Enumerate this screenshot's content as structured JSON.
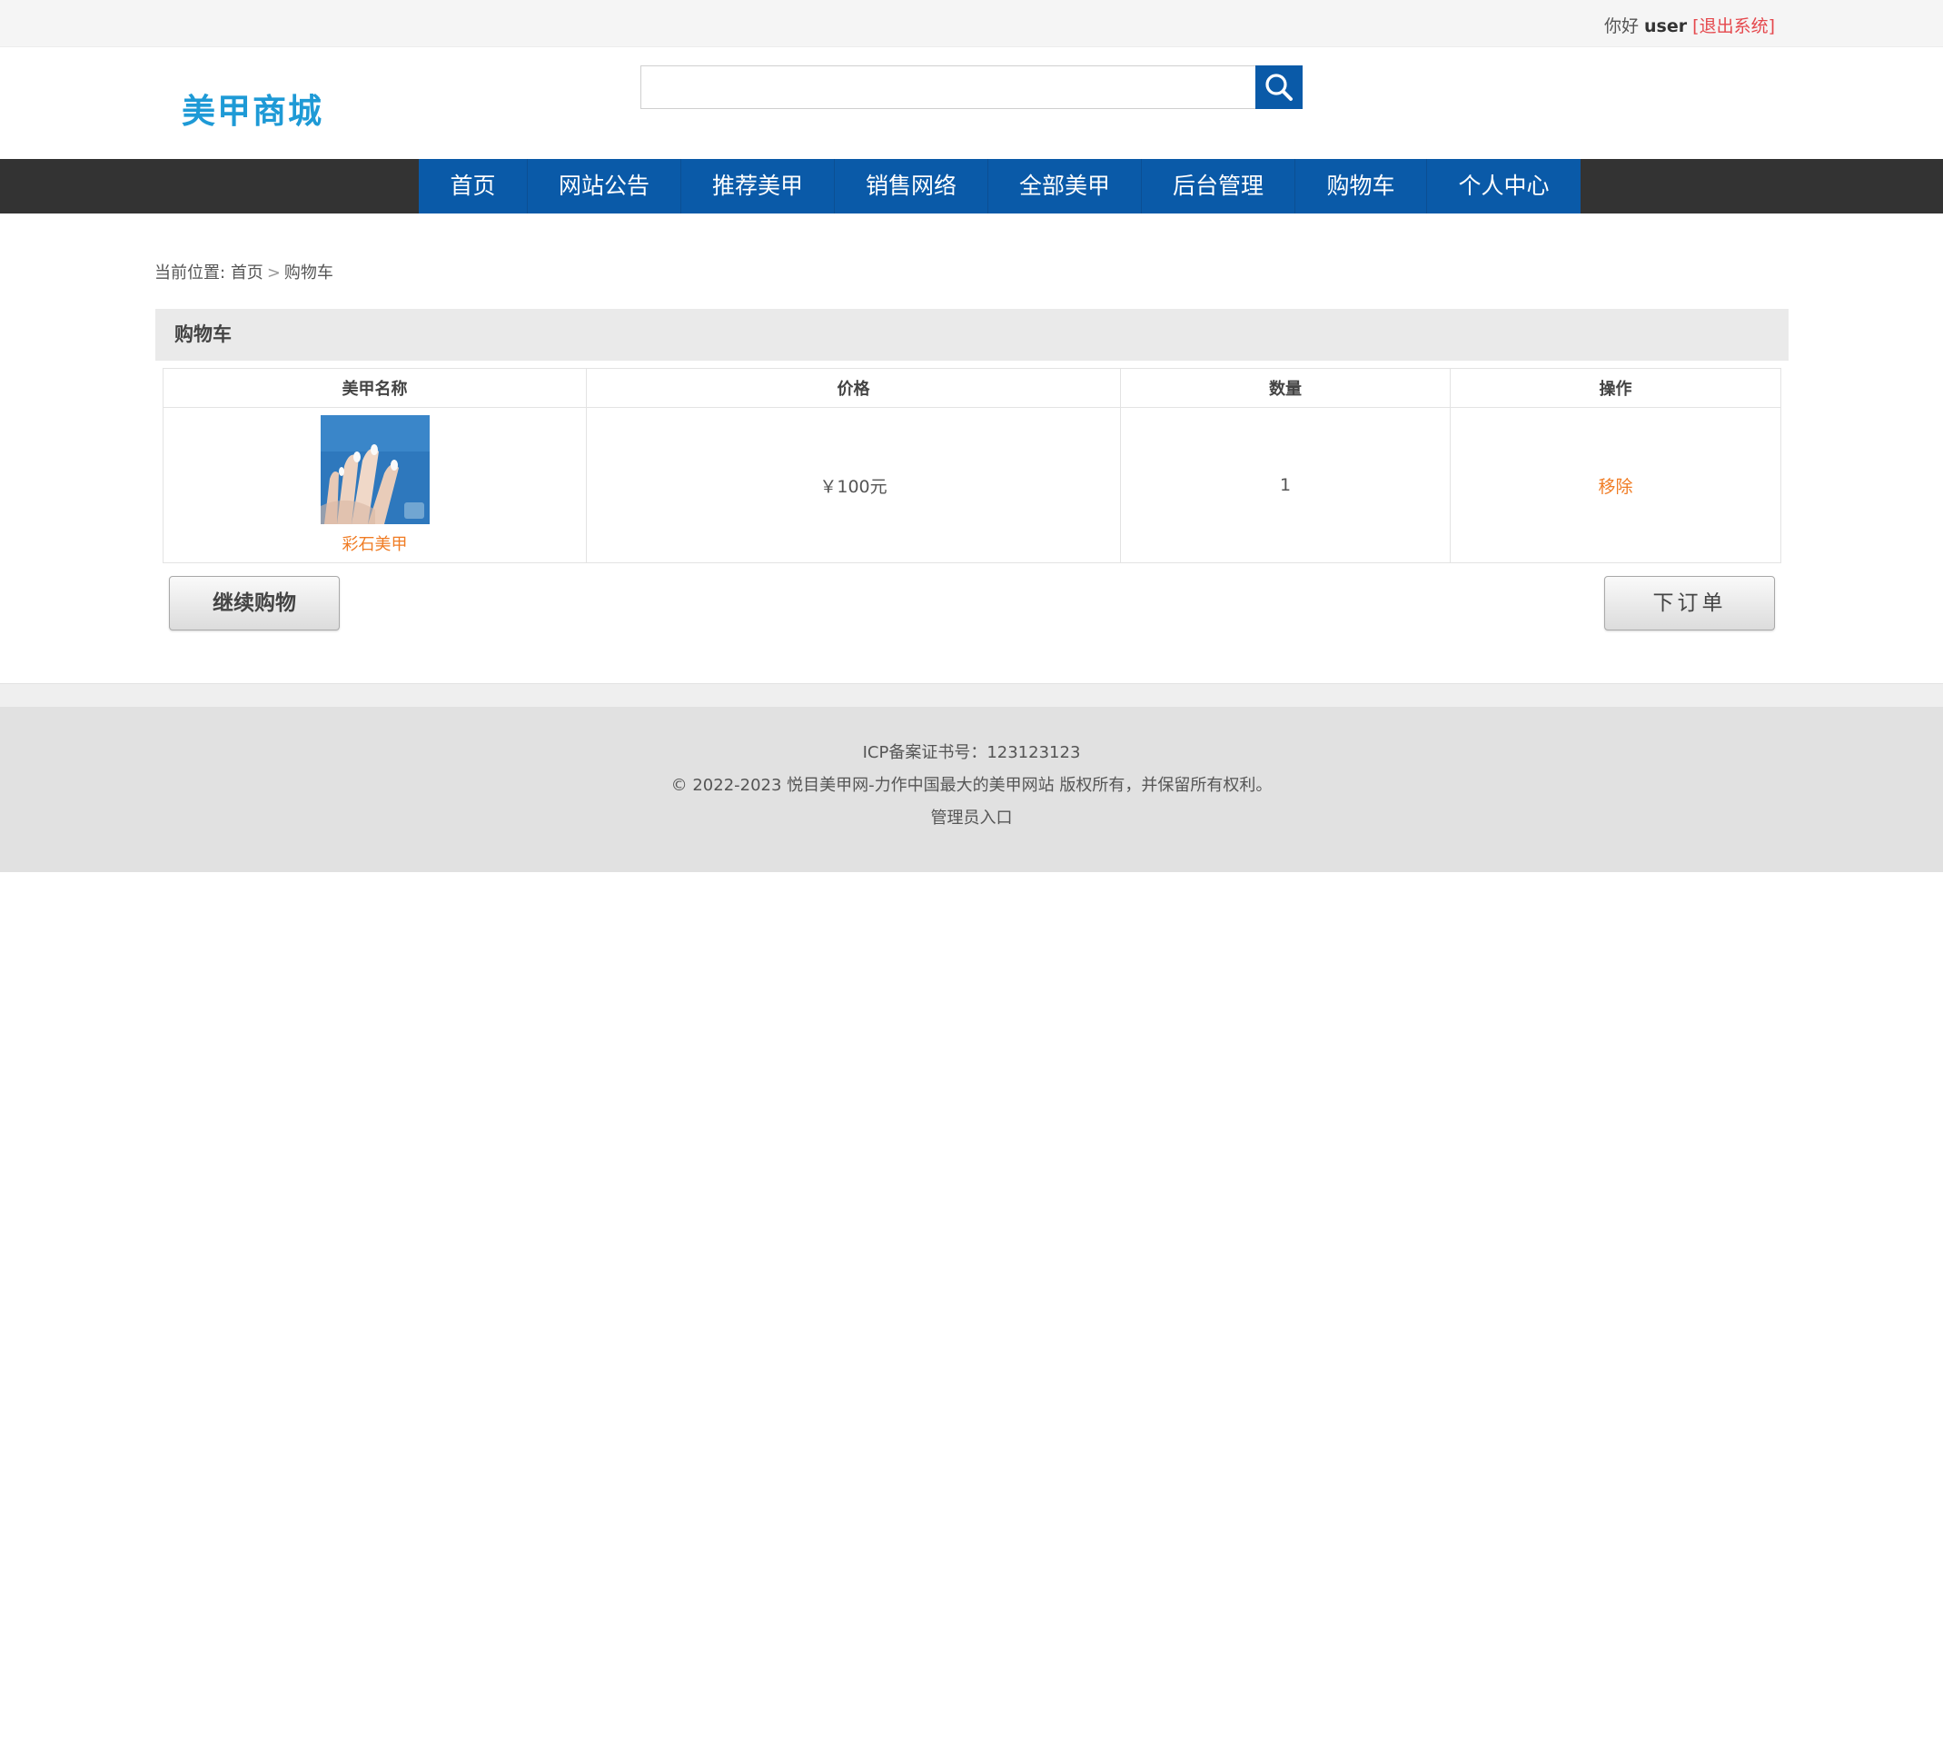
{
  "topbar": {
    "hello": "你好",
    "username": "user",
    "logout": "[退出系统]"
  },
  "header": {
    "logo": "美甲商城",
    "search_placeholder": ""
  },
  "nav": [
    {
      "label": "首页"
    },
    {
      "label": "网站公告"
    },
    {
      "label": "推荐美甲"
    },
    {
      "label": "销售网络"
    },
    {
      "label": "全部美甲"
    },
    {
      "label": "后台管理"
    },
    {
      "label": "购物车"
    },
    {
      "label": "个人中心"
    }
  ],
  "breadcrumb": {
    "prefix": "当前位置:",
    "home": "首页",
    "separator": ">",
    "current": "购物车"
  },
  "cart": {
    "title": "购物车",
    "columns": {
      "name": "美甲名称",
      "price": "价格",
      "quantity": "数量",
      "action": "操作"
    },
    "items": [
      {
        "name": "彩石美甲",
        "price": "￥100元",
        "quantity": "1",
        "action": "移除"
      }
    ],
    "continue_label": "继续购物",
    "order_label": "下订单"
  },
  "footer": {
    "icp": "ICP备案证书号：123123123",
    "copyright": "© 2022-2023 悦目美甲网-力作中国最大的美甲网站 版权所有，并保留所有权利。",
    "admin_link": "管理员入口"
  },
  "colors": {
    "brand_blue": "#0a5aa8",
    "logo_blue": "#1e9ad6",
    "accent_orange": "#f07c24",
    "logout_red": "#e5484d",
    "nav_bg": "#333333"
  }
}
